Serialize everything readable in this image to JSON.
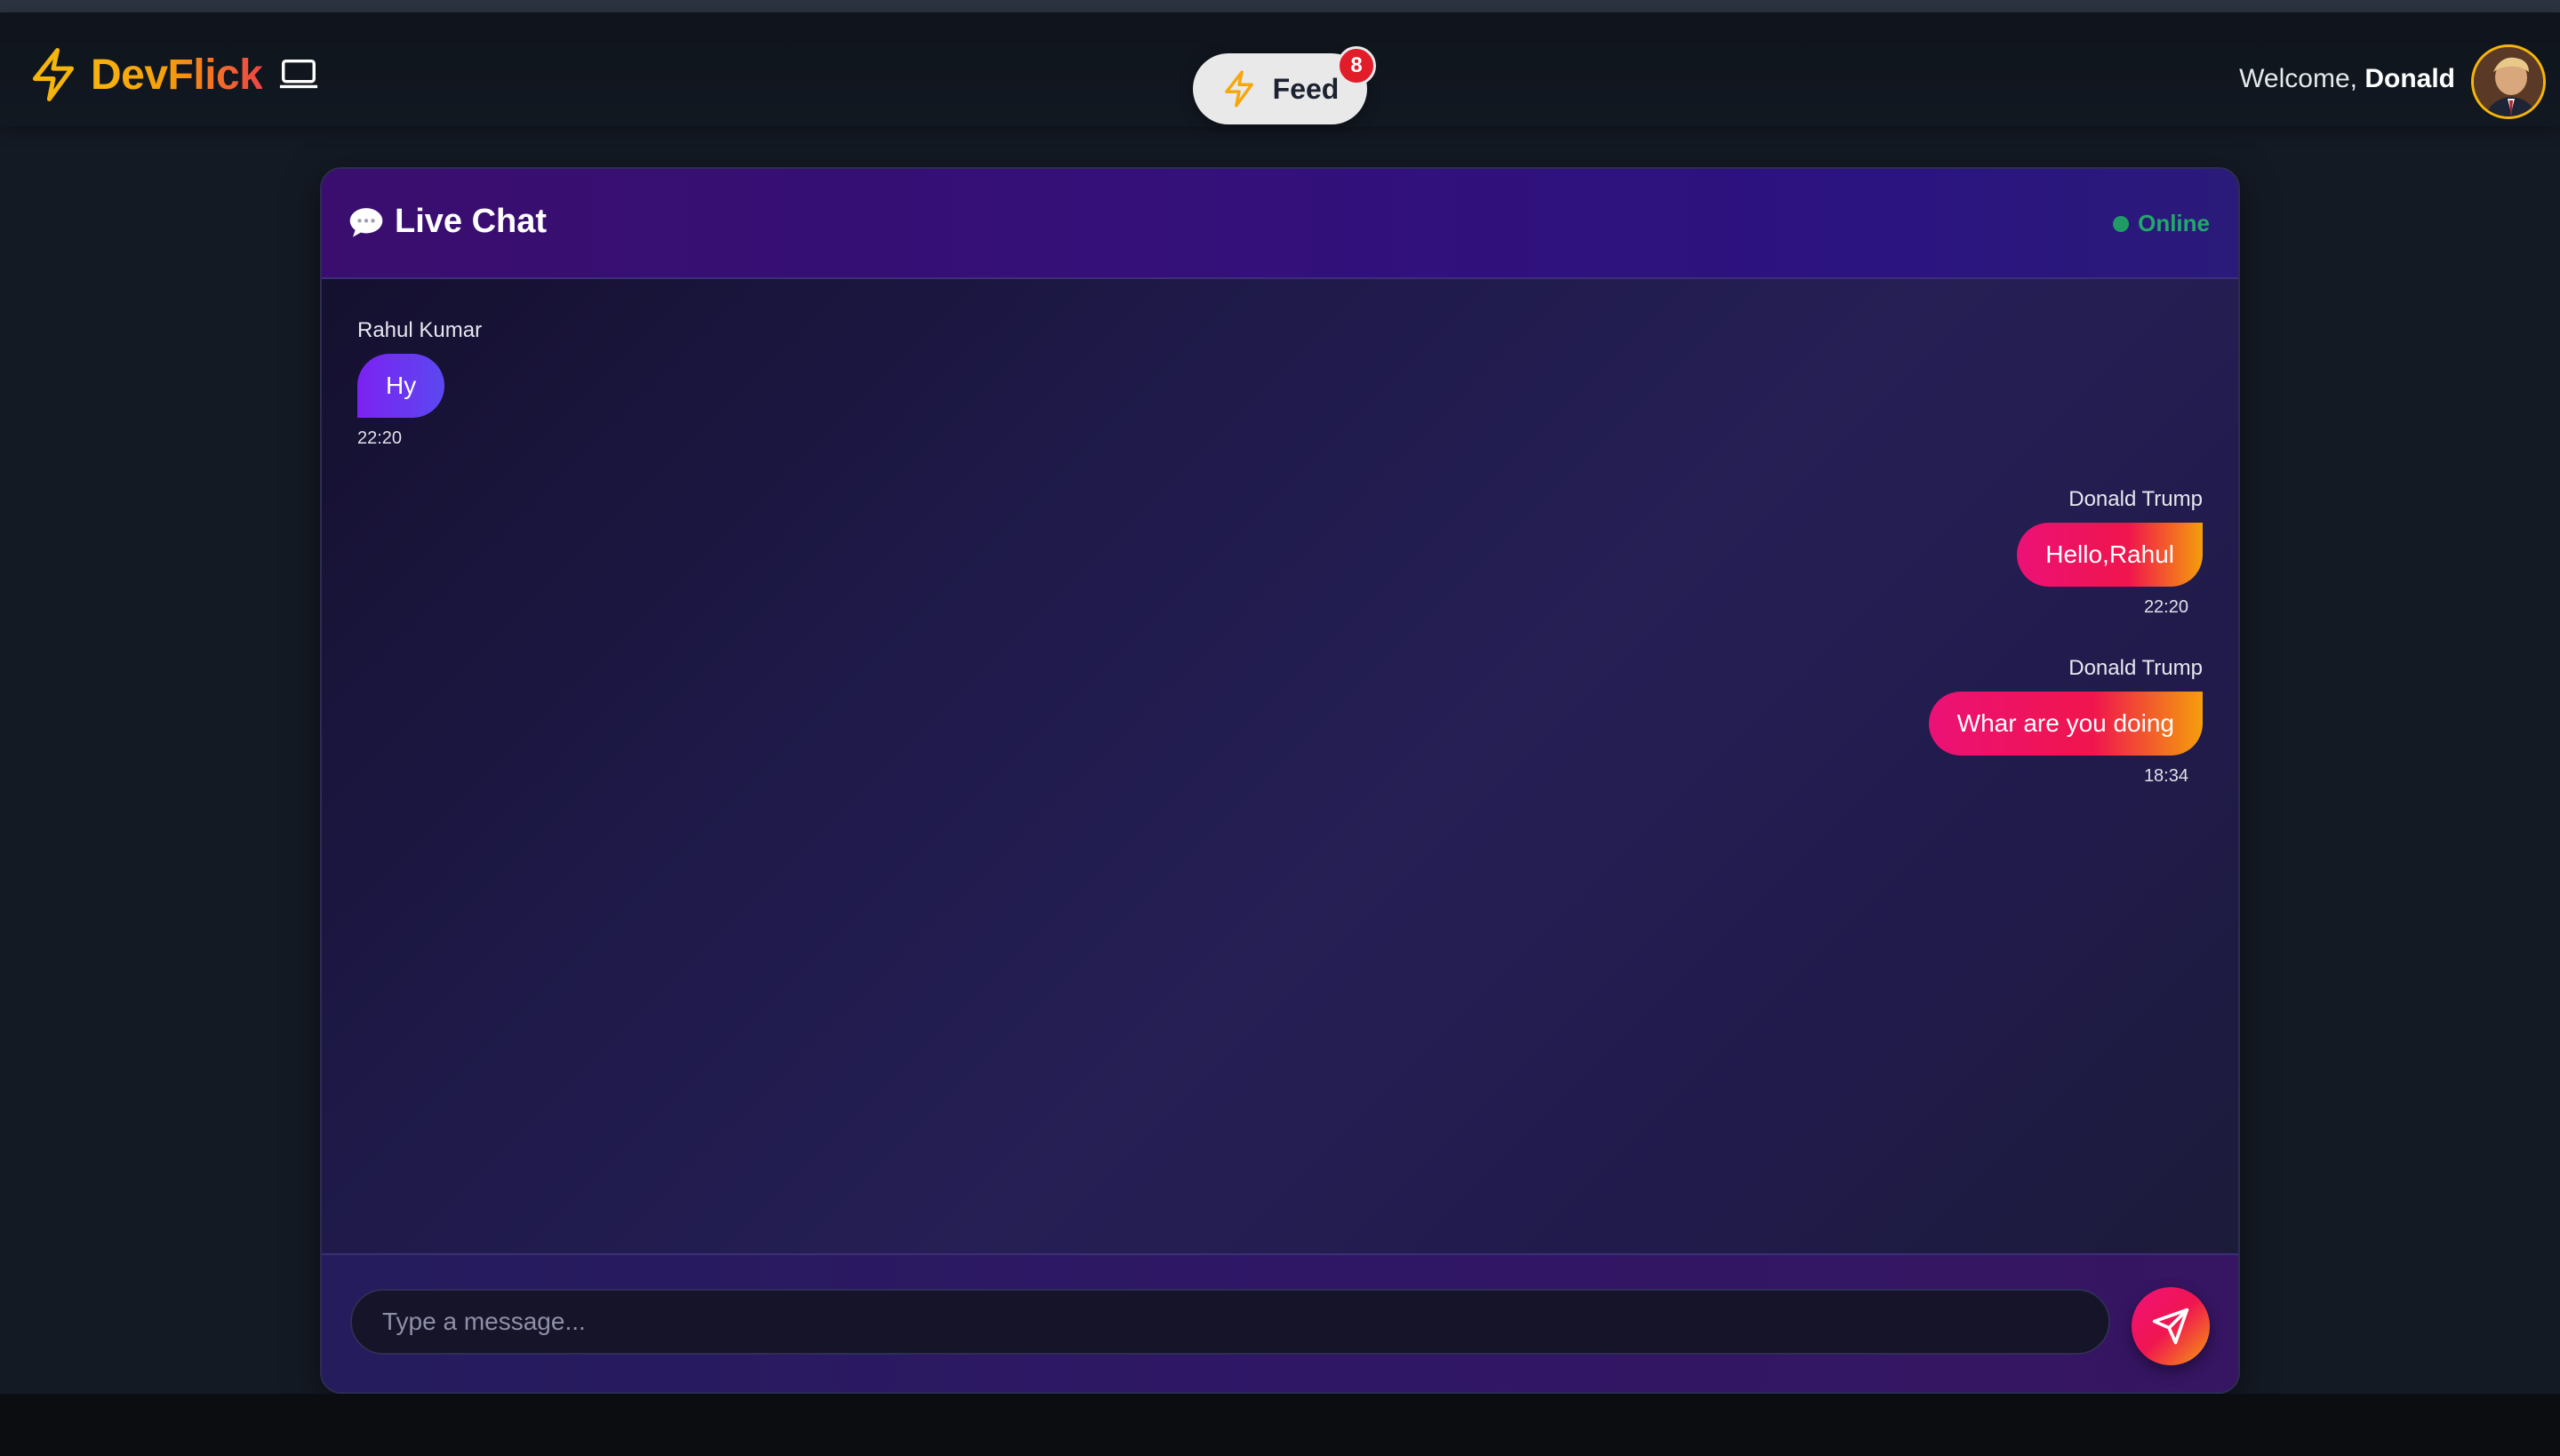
{
  "app": {
    "brand_name": "DevFlick",
    "colors": {
      "brand_gradient": [
        "#f6b40e",
        "#ef4444"
      ],
      "accent_yellow": "#f5b50a",
      "badge_red": "#e11d2a",
      "online_green": "#22a86b"
    }
  },
  "navbar": {
    "feed_label": "Feed",
    "feed_badge_count": "8",
    "welcome_prefix": "Welcome,",
    "welcome_name": "Donald",
    "icons": [
      "bolt-icon",
      "laptop-icon",
      "avatar"
    ]
  },
  "chat": {
    "title": "Live Chat",
    "status": "Online",
    "messages": [
      {
        "sender": "Rahul Kumar",
        "text": "Hy",
        "time": "22:20",
        "side": "left"
      },
      {
        "sender": "Donald Trump",
        "text": "Hello,Rahul",
        "time": "22:20",
        "side": "right"
      },
      {
        "sender": "Donald Trump",
        "text": "Whar are you doing",
        "time": "18:34",
        "side": "right"
      }
    ],
    "composer": {
      "placeholder": "Type a message..."
    }
  }
}
